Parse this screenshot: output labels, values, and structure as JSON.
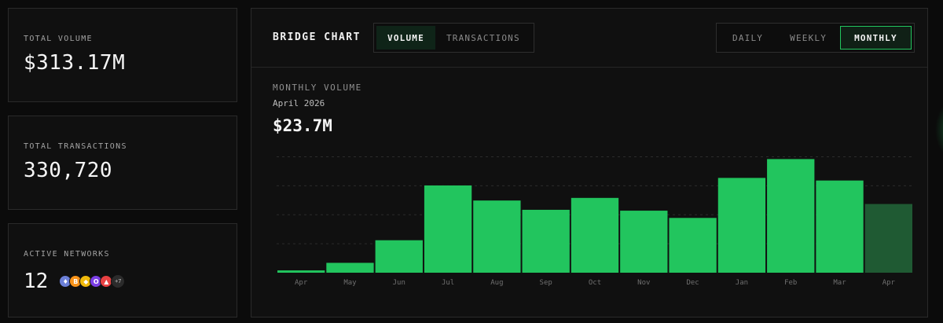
{
  "stats": {
    "volume": {
      "label": "TOTAL VOLUME",
      "value": "$313.17M"
    },
    "transactions": {
      "label": "TOTAL TRANSACTIONS",
      "value": "330,720"
    },
    "networks": {
      "label": "ACTIVE NETWORKS",
      "count": "12",
      "icons": [
        {
          "name": "ethereum-icon",
          "glyph": "♦",
          "color": "#6b7fd7"
        },
        {
          "name": "bitcoin-icon",
          "glyph": "B",
          "color": "#f7931a"
        },
        {
          "name": "bnb-icon",
          "glyph": "◆",
          "color": "#f0b90b"
        },
        {
          "name": "optimism-icon",
          "glyph": "O",
          "color": "#7b3fe4"
        },
        {
          "name": "avalanche-icon",
          "glyph": "▲",
          "color": "#e84142"
        }
      ],
      "more": "+7"
    }
  },
  "chart_panel": {
    "title": "BRIDGE CHART",
    "metric_tabs": [
      {
        "label": "VOLUME",
        "active": true
      },
      {
        "label": "TRANSACTIONS",
        "active": false
      }
    ],
    "range_tabs": [
      {
        "label": "DAILY",
        "active": false
      },
      {
        "label": "WEEKLY",
        "active": false
      },
      {
        "label": "MONTHLY",
        "active": true
      }
    ],
    "subtitle": "MONTHLY VOLUME",
    "selected_period": "April 2026",
    "selected_value": "$23.7M"
  },
  "chart_data": {
    "type": "bar",
    "categories": [
      "Apr",
      "May",
      "Jun",
      "Jul",
      "Aug",
      "Sep",
      "Oct",
      "Nov",
      "Dec",
      "Jan",
      "Feb",
      "Mar",
      "Apr"
    ],
    "values": [
      0.8,
      3.4,
      11.2,
      30.1,
      24.9,
      21.7,
      25.8,
      21.4,
      18.9,
      32.7,
      39.2,
      31.8,
      23.7
    ],
    "highlighted_index": 12,
    "ylim": [
      0,
      45
    ],
    "grid": true,
    "colors": {
      "bar": "#22c55e",
      "bar_current": "#1f5a33",
      "grid": "#2b2b2b",
      "tick": "#6f6f6f"
    }
  }
}
